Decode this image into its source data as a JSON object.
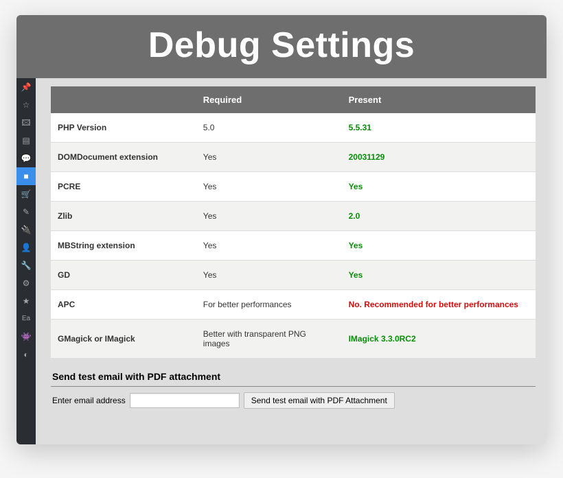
{
  "title": "Debug Settings",
  "sidebar": {
    "active_index": 5
  },
  "table": {
    "headers": {
      "col0": "",
      "col1": "Required",
      "col2": "Present"
    },
    "rows": [
      {
        "name": "PHP Version",
        "required": "5.0",
        "present": "5.5.31",
        "status": "ok"
      },
      {
        "name": "DOMDocument extension",
        "required": "Yes",
        "present": "20031129",
        "status": "ok"
      },
      {
        "name": "PCRE",
        "required": "Yes",
        "present": "Yes",
        "status": "ok"
      },
      {
        "name": "Zlib",
        "required": "Yes",
        "present": "2.0",
        "status": "ok"
      },
      {
        "name": "MBString extension",
        "required": "Yes",
        "present": "Yes",
        "status": "ok"
      },
      {
        "name": "GD",
        "required": "Yes",
        "present": "Yes",
        "status": "ok"
      },
      {
        "name": "APC",
        "required": "For better performances",
        "present": "No. Recommended for better performances",
        "status": "bad"
      },
      {
        "name": "GMagick or IMagick",
        "required": "Better with transparent PNG images",
        "present": "IMagick 3.3.0RC2",
        "status": "ok"
      }
    ]
  },
  "email_section": {
    "heading": "Send test email with PDF attachment",
    "label": "Enter email address",
    "input_value": "",
    "button": "Send test email with PDF Attachment"
  }
}
